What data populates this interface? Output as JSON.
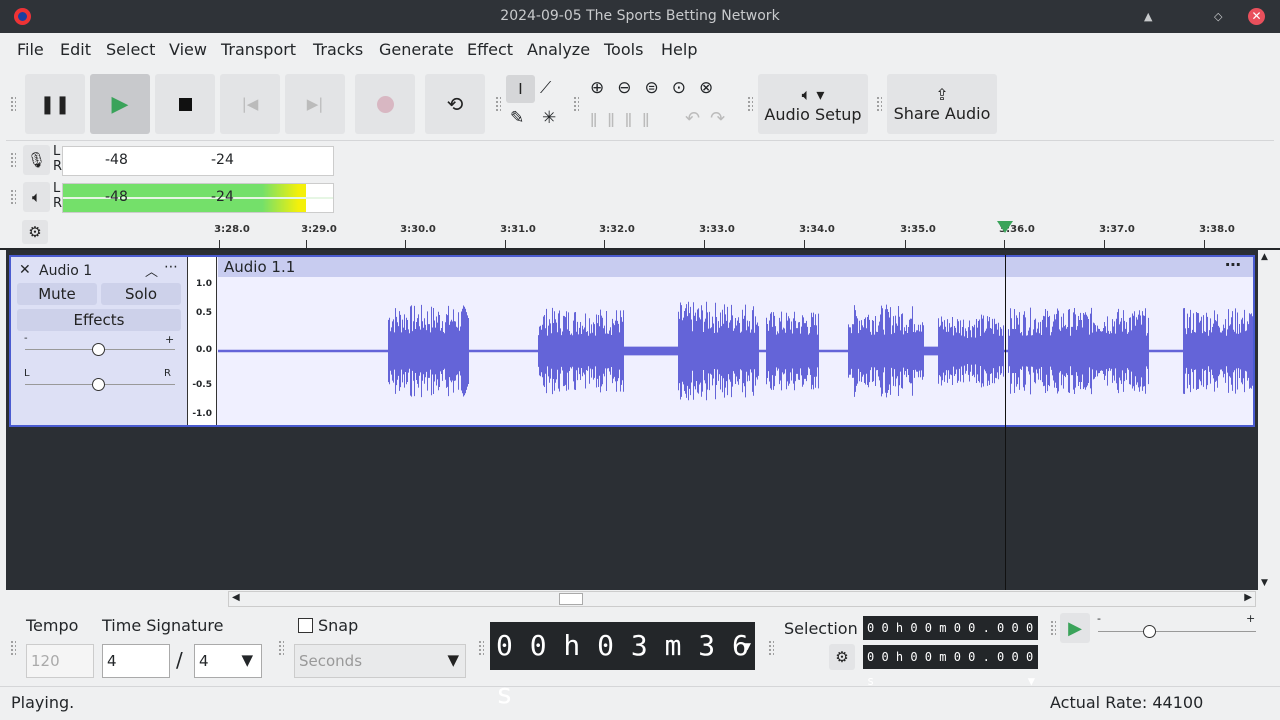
{
  "window": {
    "title": "2024-09-05 The Sports Betting Network"
  },
  "menu": [
    "File",
    "Edit",
    "Select",
    "View",
    "Transport",
    "Tracks",
    "Generate",
    "Effect",
    "Analyze",
    "Tools",
    "Help"
  ],
  "toolbar": {
    "audio_setup": "Audio Setup",
    "share_audio": "Share Audio"
  },
  "meters": {
    "ticks": [
      "-48",
      "-24"
    ],
    "lr": [
      "L",
      "R"
    ],
    "playback_level": 0.9
  },
  "ruler": {
    "labels": [
      "3:28.0",
      "3:29.0",
      "3:30.0",
      "3:31.0",
      "3:32.0",
      "3:33.0",
      "3:34.0",
      "3:35.0",
      "3:36.0",
      "3:37.0",
      "3:38.0"
    ]
  },
  "track": {
    "name": "Audio 1",
    "mute": "Mute",
    "solo": "Solo",
    "effects": "Effects",
    "gain_minus": "-",
    "gain_plus": "+",
    "pan_l": "L",
    "pan_r": "R",
    "clip_name": "Audio 1.1",
    "scale": [
      "1.0",
      "0.5",
      "0.0",
      "-0.5",
      "-1.0"
    ],
    "color": "#6464d8"
  },
  "bottom": {
    "tempo_label": "Tempo",
    "tempo_value": "120",
    "timesig_label": "Time Signature",
    "timesig_num": "4",
    "timesig_sep": "/",
    "timesig_den": "4",
    "snap_label": "Snap",
    "snap_unit": "Seconds",
    "time_display": "0 0 h 0 3 m 3 6 s",
    "selection_label": "Selection",
    "sel_start": "0 0 h 0 0 m 0 0 . 0 0 0 s",
    "sel_end": "0 0 h 0 0 m 0 0 . 0 0 0 s",
    "speed_minus": "-",
    "speed_plus": "+"
  },
  "status": {
    "text": "Playing.",
    "rate": "Actual Rate: 44100"
  }
}
